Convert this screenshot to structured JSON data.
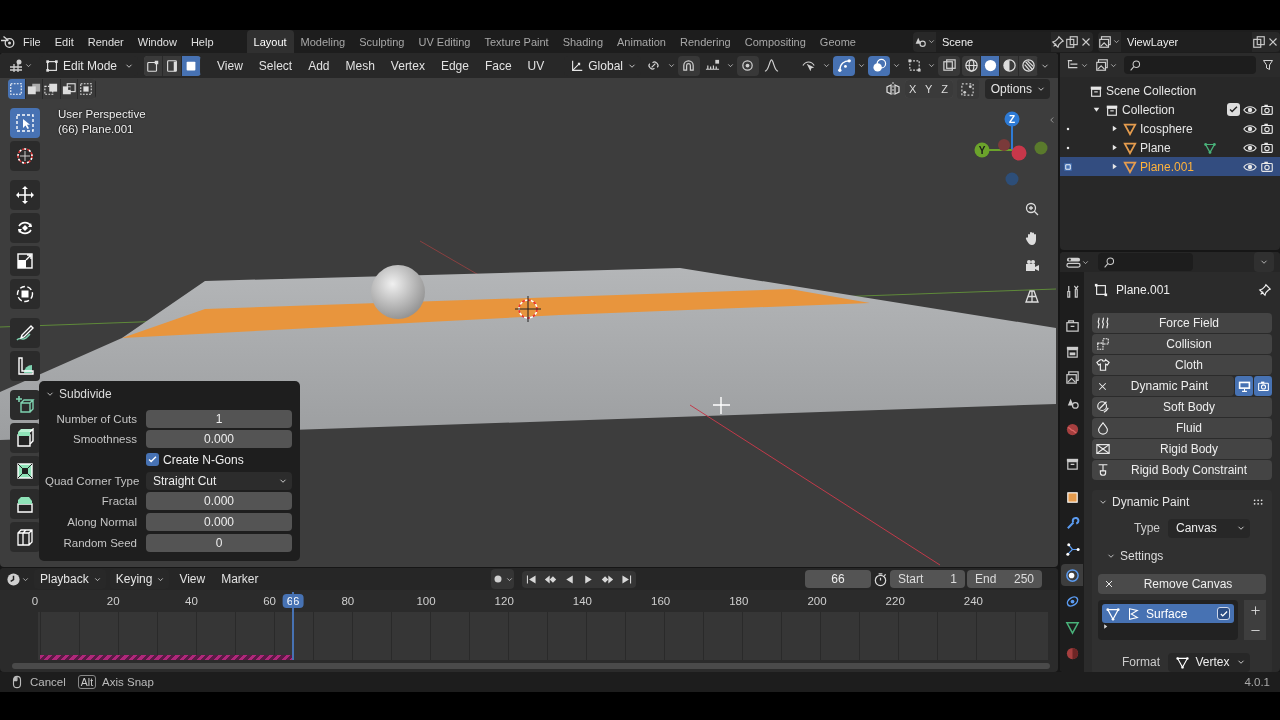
{
  "menu_bar": {
    "menus": [
      "File",
      "Edit",
      "Render",
      "Window",
      "Help"
    ],
    "workspaces": [
      {
        "label": "Layout",
        "selected": true
      },
      {
        "label": "Modeling",
        "selected": false
      },
      {
        "label": "Sculpting",
        "selected": false
      },
      {
        "label": "UV Editing",
        "selected": false
      },
      {
        "label": "Texture Paint",
        "selected": false
      },
      {
        "label": "Shading",
        "selected": false
      },
      {
        "label": "Animation",
        "selected": false
      },
      {
        "label": "Rendering",
        "selected": false
      },
      {
        "label": "Compositing",
        "selected": false
      },
      {
        "label": "Geome",
        "selected": false
      }
    ],
    "scene": "Scene",
    "view_layer": "ViewLayer"
  },
  "viewport_header": {
    "mode": "Edit Mode",
    "select_modes": [
      {
        "kind": "vertex",
        "selected": false
      },
      {
        "kind": "edge",
        "selected": false
      },
      {
        "kind": "face",
        "selected": true
      }
    ],
    "menus": [
      "View",
      "Select",
      "Add",
      "Mesh",
      "Vertex",
      "Edge",
      "Face",
      "UV"
    ],
    "orientation": "Global",
    "snap": false,
    "proportional_editing": false,
    "show_gizmos": true,
    "show_overlays": true,
    "xray": false,
    "shading": [
      {
        "kind": "wireframe",
        "selected": false
      },
      {
        "kind": "solid",
        "selected": true
      },
      {
        "kind": "material",
        "selected": false
      },
      {
        "kind": "rendered",
        "selected": false
      }
    ],
    "selection_actions": [
      {
        "kind": "set",
        "selected": true
      },
      {
        "kind": "extend",
        "selected": false
      },
      {
        "kind": "subtract",
        "selected": false
      },
      {
        "kind": "invert",
        "selected": false
      },
      {
        "kind": "intersect",
        "selected": false
      }
    ],
    "mirror_axes": [
      {
        "label": "X",
        "selected": false
      },
      {
        "label": "Y",
        "selected": false
      },
      {
        "label": "Z",
        "selected": false
      }
    ],
    "options": "Options"
  },
  "viewport": {
    "view_name": "User Perspective",
    "object_info": "(66) Plane.001",
    "gizmo_axes": [
      {
        "label": "Z",
        "color": "#2e7bd6"
      },
      {
        "label": "Y",
        "color": "#6ba32b"
      }
    ]
  },
  "tools": [
    {
      "kind": "select-box",
      "selected": true
    },
    {
      "kind": "cursor",
      "selected": false
    },
    {
      "kind": "move",
      "selected": false
    },
    {
      "kind": "rotate",
      "selected": false
    },
    {
      "kind": "scale",
      "selected": false
    },
    {
      "kind": "transform",
      "selected": false
    },
    {
      "kind": "annotate",
      "selected": false
    },
    {
      "kind": "measure",
      "selected": false
    },
    {
      "kind": "add-cube",
      "selected": false
    },
    {
      "kind": "extrude",
      "selected": false
    },
    {
      "kind": "inset",
      "selected": false
    },
    {
      "kind": "bevel",
      "selected": false
    },
    {
      "kind": "loop-cut",
      "selected": false
    }
  ],
  "operator_panel": {
    "title": "Subdivide",
    "expanded": true,
    "fields": [
      {
        "kind": "number",
        "label": "Number of Cuts",
        "value": "1"
      },
      {
        "kind": "number",
        "label": "Smoothness",
        "value": "0.000"
      },
      {
        "kind": "checkbox",
        "label": "Create N-Gons",
        "checked": true
      },
      {
        "kind": "dropdown",
        "label": "Quad Corner Type",
        "value": "Straight Cut"
      },
      {
        "kind": "number",
        "label": "Fractal",
        "value": "0.000"
      },
      {
        "kind": "number",
        "label": "Along Normal",
        "value": "0.000"
      },
      {
        "kind": "number",
        "label": "Random Seed",
        "value": "0"
      }
    ]
  },
  "outliner": {
    "root": "Scene Collection",
    "items": [
      {
        "label": "Collection",
        "kind": "collection",
        "expanded": true,
        "checked": true,
        "selected": false,
        "data_icon": false,
        "children": [
          {
            "label": "Icosphere",
            "kind": "mesh",
            "expanded": false,
            "selected": false,
            "data_icon": false
          },
          {
            "label": "Plane",
            "kind": "mesh",
            "expanded": false,
            "selected": false,
            "data_icon": true
          },
          {
            "label": "Plane.001",
            "kind": "mesh",
            "expanded": false,
            "selected": true,
            "data_icon": false
          }
        ]
      }
    ]
  },
  "properties": {
    "tabs": [
      {
        "kind": "tool",
        "selected": false
      },
      {
        "kind": "render",
        "selected": false
      },
      {
        "kind": "output",
        "selected": false
      },
      {
        "kind": "view-layer",
        "selected": false
      },
      {
        "kind": "scene",
        "selected": false
      },
      {
        "kind": "world",
        "selected": false
      },
      {
        "kind": "collection",
        "selected": false
      },
      {
        "kind": "object",
        "selected": false
      },
      {
        "kind": "modifiers",
        "selected": false
      },
      {
        "kind": "particles",
        "selected": false
      },
      {
        "kind": "physics",
        "selected": true
      },
      {
        "kind": "constraints",
        "selected": false
      },
      {
        "kind": "data",
        "selected": false
      },
      {
        "kind": "material",
        "selected": false
      }
    ],
    "object_name": "Plane.001",
    "physics": [
      {
        "kind": "force-field",
        "label": "Force Field",
        "enabled": false
      },
      {
        "kind": "collision",
        "label": "Collision",
        "enabled": false
      },
      {
        "kind": "cloth",
        "label": "Cloth",
        "enabled": false
      },
      {
        "kind": "dynamic-paint",
        "label": "Dynamic Paint",
        "enabled": true
      },
      {
        "kind": "soft-body",
        "label": "Soft Body",
        "enabled": false
      },
      {
        "kind": "fluid",
        "label": "Fluid",
        "enabled": false
      },
      {
        "kind": "rigid-body",
        "label": "Rigid Body",
        "enabled": false
      },
      {
        "kind": "rigid-body-constraint",
        "label": "Rigid Body Constraint",
        "enabled": false
      }
    ],
    "panel": {
      "title": "Dynamic Paint",
      "expanded": true,
      "type_label": "Type",
      "type": "Canvas",
      "settings": {
        "title": "Settings",
        "expanded": true,
        "remove": "Remove Canvas",
        "surfaces": [
          {
            "name": "Surface",
            "selected": true,
            "checked": true
          }
        ],
        "format_label": "Format",
        "format": "Vertex"
      }
    }
  },
  "timeline": {
    "menus": [
      {
        "label": "Playback",
        "dropdown": true
      },
      {
        "label": "Keying",
        "dropdown": true
      },
      {
        "label": "View",
        "dropdown": false
      },
      {
        "label": "Marker",
        "dropdown": false
      }
    ],
    "current_frame": "66",
    "start_label": "Start",
    "start": "1",
    "end_label": "End",
    "end": "250",
    "ruler": [
      "0",
      "20",
      "40",
      "60",
      "80",
      "100",
      "120",
      "140",
      "160",
      "180",
      "200",
      "220",
      "240"
    ],
    "playhead": {
      "label": "66",
      "level": 0.264
    }
  },
  "status_bar": {
    "hints": [
      {
        "kind": "mouse",
        "label": "Cancel"
      },
      {
        "kind": "key",
        "key": "Alt",
        "label": "Axis Snap"
      }
    ],
    "version": "4.0.1"
  }
}
